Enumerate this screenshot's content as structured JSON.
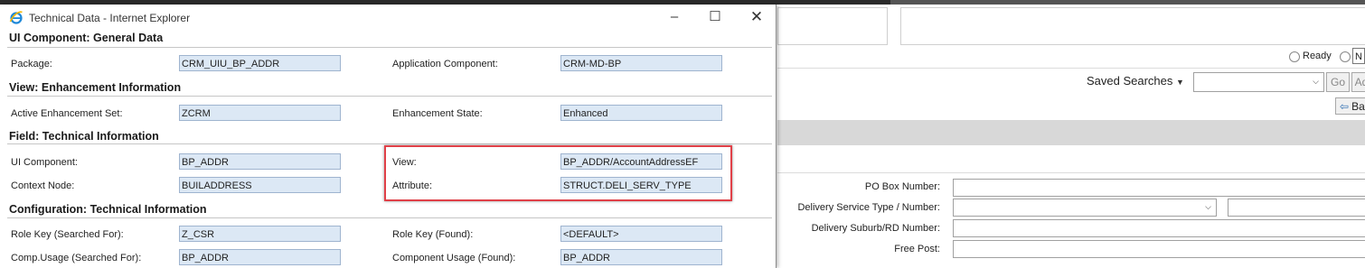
{
  "window": {
    "title": "Technical Data - Internet Explorer",
    "icon": "internet-explorer-icon",
    "controls": [
      "minimize-icon",
      "maximize-icon",
      "close-icon"
    ]
  },
  "sections": {
    "ui_component": {
      "heading": "UI Component: General Data",
      "package_label": "Package:",
      "package_value": "CRM_UIU_BP_ADDR",
      "app_component_label": "Application Component:",
      "app_component_value": "CRM-MD-BP"
    },
    "view_enh": {
      "heading": "View: Enhancement Information",
      "enh_set_label": "Active Enhancement Set:",
      "enh_set_value": "ZCRM",
      "enh_state_label": "Enhancement State:",
      "enh_state_value": "Enhanced"
    },
    "field_tech": {
      "heading": "Field: Technical Information",
      "ui_comp_label": "UI Component:",
      "ui_comp_value": "BP_ADDR",
      "view_label": "View:",
      "view_value": "BP_ADDR/AccountAddressEF",
      "context_node_label": "Context Node:",
      "context_node_value": "BUILADDRESS",
      "attribute_label": "Attribute:",
      "attribute_value": "STRUCT.DELI_SERV_TYPE"
    },
    "config_tech": {
      "heading": "Configuration: Technical Information",
      "role_searched_label": "Role Key (Searched For):",
      "role_searched_value": "Z_CSR",
      "role_found_label": "Role Key (Found):",
      "role_found_value": "<DEFAULT>",
      "comp_usage_searched_label": "Comp.Usage (Searched For):",
      "comp_usage_searched_value": "BP_ADDR",
      "comp_usage_found_label": "Component Usage (Found):",
      "comp_usage_found_value": "BP_ADDR"
    }
  },
  "background": {
    "ready_label": "Ready",
    "radio2_label": "N",
    "saved_searches_label": "Saved Searches",
    "go_button": "Go",
    "ad_button": "Ad",
    "back_button": "Ba",
    "form": {
      "po_box_label": "PO Box Number:",
      "delivery_type_label": "Delivery Service Type / Number:",
      "delivery_suburb_label": "Delivery Suburb/RD Number:",
      "free_post_label": "Free Post:"
    }
  },
  "colors": {
    "field_bg": "#dce8f5",
    "field_border": "#9fb4cf",
    "highlight": "#e04048"
  }
}
